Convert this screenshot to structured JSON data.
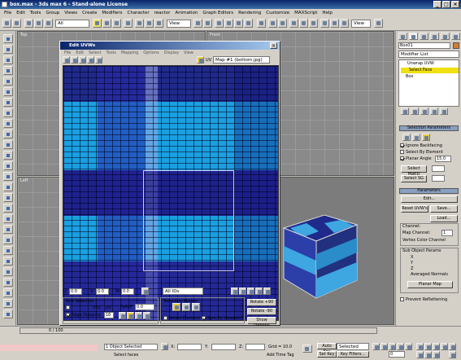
{
  "window": {
    "title": "box.max - 3ds max 6 - Stand-alone License"
  },
  "menu": [
    "File",
    "Edit",
    "Tools",
    "Group",
    "Views",
    "Create",
    "Modifiers",
    "Character",
    "reactor",
    "Animation",
    "Graph Editors",
    "Rendering",
    "Customize",
    "MAXScript",
    "Help"
  ],
  "toolbar": {
    "filter": "All",
    "coord": "View",
    "viewcombo": "View"
  },
  "viewports": {
    "top": "Top",
    "front": "Front",
    "left": "Left"
  },
  "uvw": {
    "title": "Edit UVWs",
    "menu": [
      "File",
      "Edit",
      "Select",
      "Tools",
      "Mapping",
      "Options",
      "Display",
      "View"
    ],
    "map": "Map #1 (bottom.jpg)",
    "uv": "UV",
    "u_label": "U:",
    "u_val": "0.0",
    "v_label": "V:",
    "v_val": "0.0",
    "w_label": "W:",
    "w_val": "0.0",
    "ids": "All IDs",
    "softsel_title": "Soft Selection",
    "xyz": "XYZ",
    "uv_radio": "UV",
    "falloff": "Falloff",
    "falloff_val": "0.0",
    "edge_distance": "Edge Distance",
    "edge_val": "16",
    "selmodes_title": "Selection Modes",
    "select_element": "Select Element",
    "sync": "Sync to Viewport",
    "rotate_p": "Rotate +90",
    "rotate_m": "Rotate -90",
    "show_options": "Show Options"
  },
  "cmd": {
    "objname": "Box01",
    "modlist": "Modifier List",
    "stack": [
      "Unwrap UVW",
      "Select Face",
      "Box"
    ],
    "sel_params": "Selection Parameters",
    "ignore_backfacing": "Ignore Backfacing",
    "select_by_element": "Select By Element",
    "planar_angle": "Planar Angle",
    "planar_val": "15.0",
    "select_matid": "Select MatID",
    "select_sg": "Select SG",
    "params": "Parameters",
    "edit": "Edit...",
    "reset_uvws": "Reset UVW's",
    "save": "Save...",
    "load": "Load...",
    "channel": "Channel:",
    "map_channel": "Map Channel:",
    "map_channel_val": "1",
    "vertex_color": "Vertex Color Channel",
    "sub_object": "Sub Object Params",
    "x": "X",
    "y": "Y",
    "z": "Z",
    "averaged": "Averaged Normals",
    "planar_map": "Planar Map",
    "prevent": "Prevent Reflattening"
  },
  "status": {
    "time": "0 / 100",
    "objects": "1 Object Selected",
    "prompt": "Select faces",
    "x": "X:",
    "y": "Y:",
    "z": "Z:",
    "grid": "Grid = 10.0",
    "add_time_tag": "Add Time Tag",
    "auto_key": "Auto Key",
    "selected": "Selected",
    "set_key": "Set Key",
    "key_filters": "Key Filters...",
    "frame": "0"
  }
}
